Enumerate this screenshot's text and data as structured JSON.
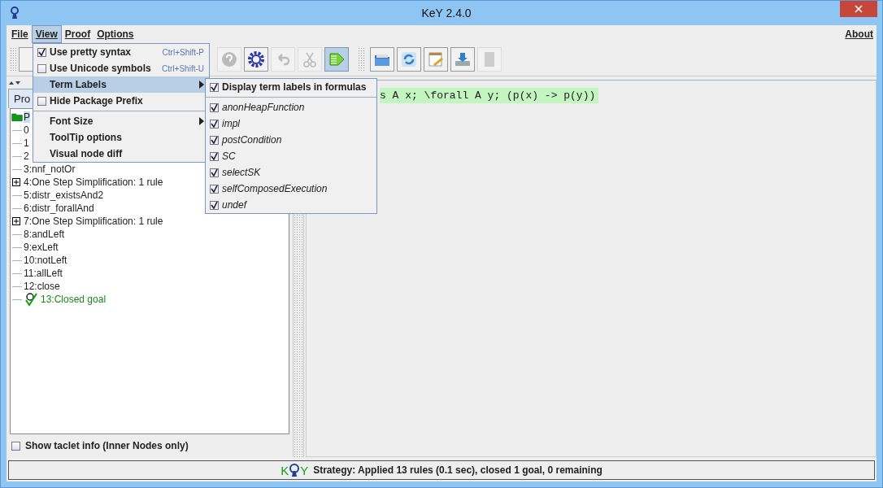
{
  "window": {
    "title": "KeY 2.4.0"
  },
  "menubar": {
    "items": [
      {
        "label": "File",
        "selected": false
      },
      {
        "label": "View",
        "selected": true
      },
      {
        "label": "Proof",
        "selected": false
      },
      {
        "label": "Options",
        "selected": false
      }
    ],
    "right": "About"
  },
  "toolbar": [
    {
      "kind": "help",
      "disabled": true,
      "selected": false
    },
    {
      "kind": "gear",
      "disabled": false,
      "selected": false
    },
    {
      "kind": "undo",
      "disabled": true,
      "selected": false
    },
    {
      "kind": "cut",
      "disabled": true,
      "selected": false
    },
    {
      "kind": "run",
      "disabled": false,
      "selected": true
    },
    {
      "kind": "sep"
    },
    {
      "kind": "open",
      "disabled": false,
      "selected": false
    },
    {
      "kind": "reload",
      "disabled": false,
      "selected": false
    },
    {
      "kind": "edit",
      "disabled": false,
      "selected": false
    },
    {
      "kind": "save",
      "disabled": false,
      "selected": false
    },
    {
      "kind": "blank",
      "disabled": true,
      "selected": false
    }
  ],
  "view_menu": [
    {
      "kind": "check",
      "label": "Use pretty syntax",
      "checked": true,
      "shortcut": "Ctrl+Shift-P"
    },
    {
      "kind": "check",
      "label": "Use Unicode symbols",
      "checked": false,
      "shortcut": "Ctrl+Shift-U"
    },
    {
      "kind": "submenu",
      "label": "Term Labels",
      "selected": true
    },
    {
      "kind": "check",
      "label": "Hide Package Prefix",
      "checked": false
    },
    {
      "kind": "sep"
    },
    {
      "kind": "submenu",
      "label": "Font Size",
      "selected": false
    },
    {
      "kind": "item",
      "label": "ToolTip options"
    },
    {
      "kind": "item",
      "label": "Visual node diff"
    }
  ],
  "term_labels_menu": {
    "display": {
      "label": "Display term labels in formulas",
      "checked": true
    },
    "labels": [
      {
        "label": "anonHeapFunction",
        "checked": true
      },
      {
        "label": "impl",
        "checked": true
      },
      {
        "label": "postCondition",
        "checked": true
      },
      {
        "label": "SC",
        "checked": true
      },
      {
        "label": "selectSK",
        "checked": true
      },
      {
        "label": "selfComposedExecution",
        "checked": true
      },
      {
        "label": "undef",
        "checked": true
      }
    ]
  },
  "left_panel": {
    "tab": "Pro",
    "tree": {
      "root": "P",
      "children": [
        {
          "label": "0",
          "expandable": false,
          "closed": false
        },
        {
          "label": "1",
          "expandable": false,
          "closed": false
        },
        {
          "label": "2",
          "expandable": false,
          "closed": false
        },
        {
          "label": "3:nnf_notOr",
          "expandable": false,
          "closed": false
        },
        {
          "label": "4:One Step Simplification: 1 rule",
          "expandable": true,
          "closed": false
        },
        {
          "label": "5:distr_existsAnd2",
          "expandable": false,
          "closed": false
        },
        {
          "label": "6:distr_forallAnd",
          "expandable": false,
          "closed": false
        },
        {
          "label": "7:One Step Simplification: 1 rule",
          "expandable": true,
          "closed": false
        },
        {
          "label": "8:andLeft",
          "expandable": false,
          "closed": false
        },
        {
          "label": "9:exLeft",
          "expandable": false,
          "closed": false
        },
        {
          "label": "10:notLeft",
          "expandable": false,
          "closed": false
        },
        {
          "label": "11:allLeft",
          "expandable": false,
          "closed": false
        },
        {
          "label": "12:close",
          "expandable": false,
          "closed": false
        },
        {
          "label": "13:Closed goal",
          "expandable": false,
          "closed": true
        }
      ]
    },
    "taclet_checkbox": {
      "label": "Show taclet info (Inner Nodes only)",
      "checked": false
    }
  },
  "sequent": "s A x; \\forall A y; (p(x) -> p(y))",
  "status_bar": {
    "text": "Strategy: Applied 13 rules (0.1 sec),  closed **1** goal, 0 remaining",
    "logo": {
      "k": "K",
      "e": "Y"
    }
  }
}
